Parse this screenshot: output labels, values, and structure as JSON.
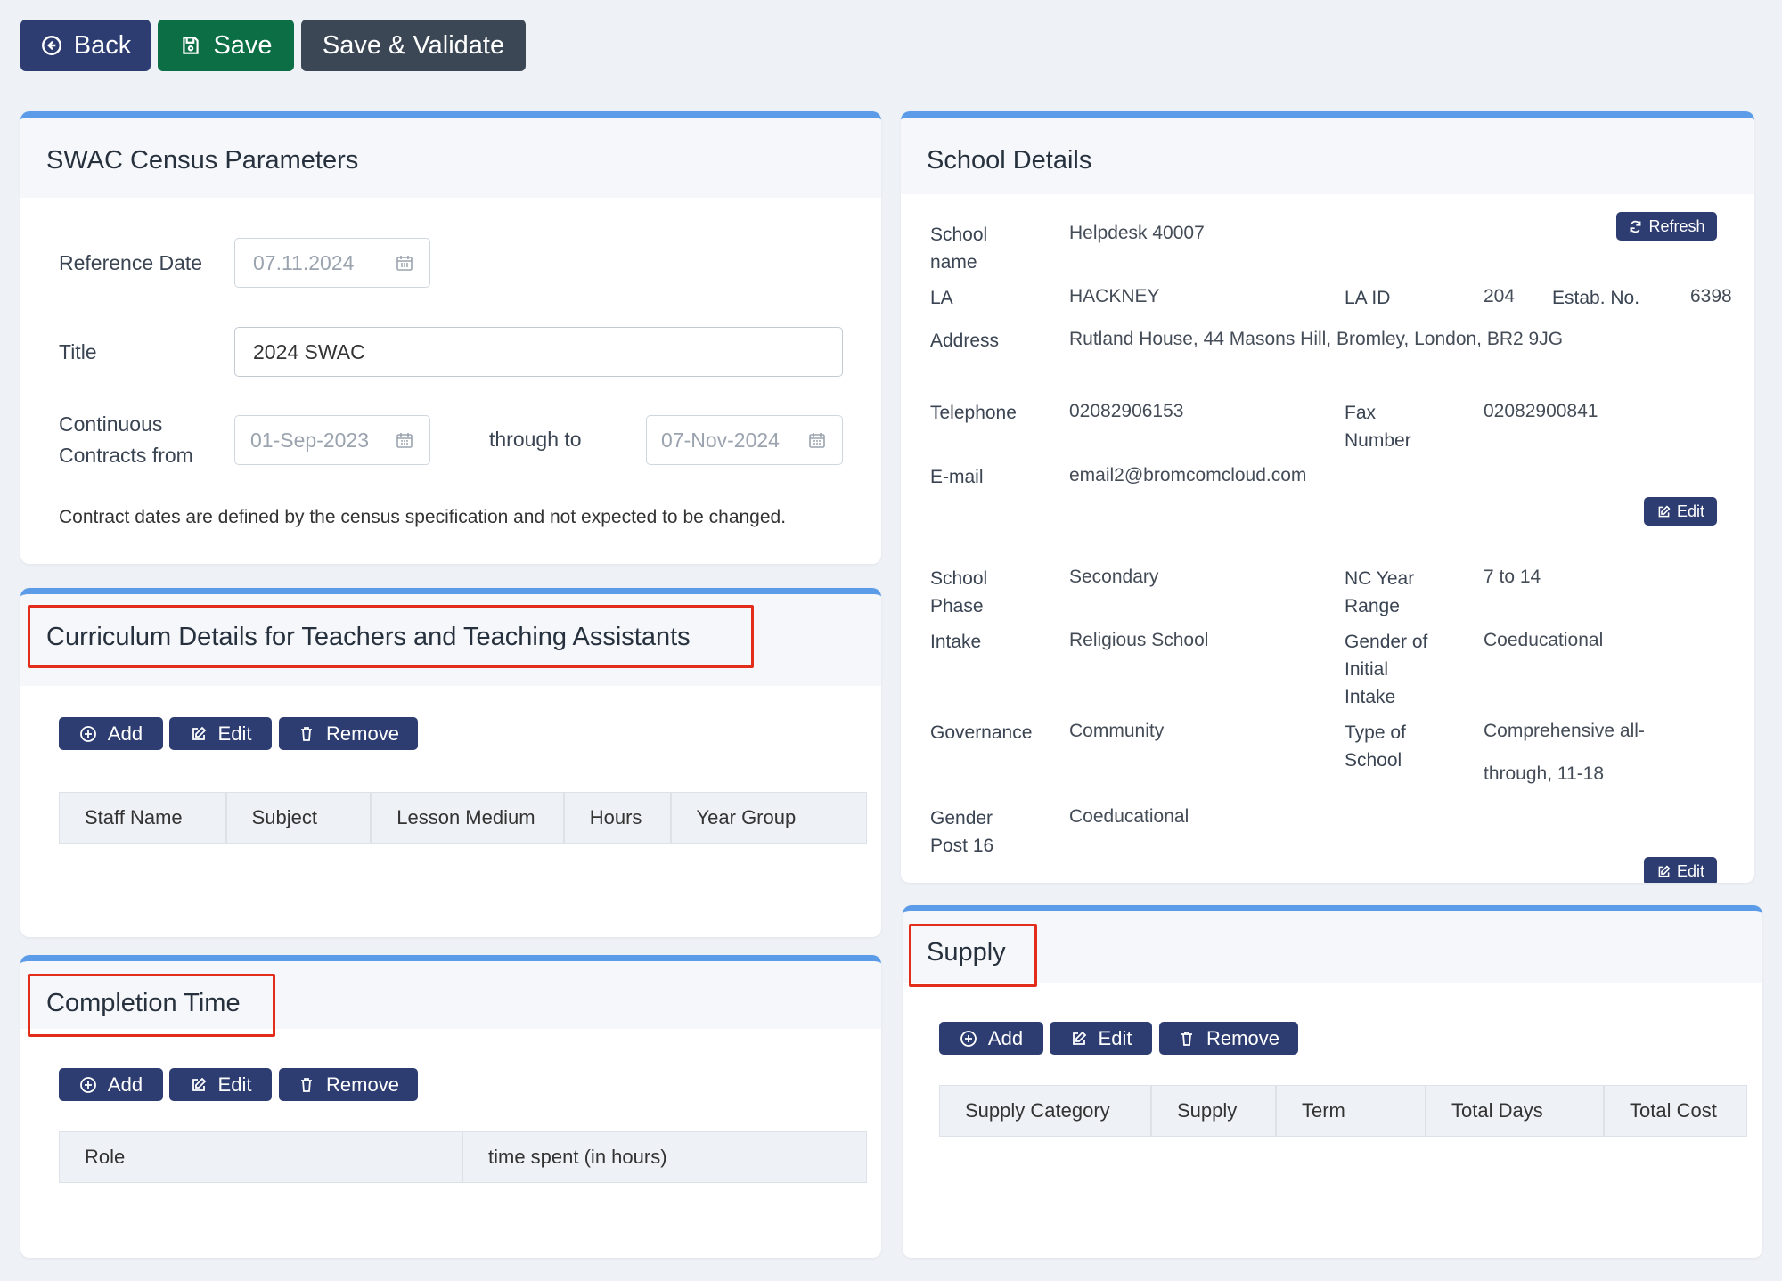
{
  "toolbar": {
    "back_label": "Back",
    "save_label": "Save",
    "save_validate_label": "Save & Validate"
  },
  "census": {
    "title": "SWAC Census Parameters",
    "reference_date_label": "Reference Date",
    "reference_date_value": "07.11.2024",
    "title_label": "Title",
    "title_value": "2024 SWAC",
    "contracts_label_line1": "Continuous",
    "contracts_label_line2": "Contracts from",
    "from_date": "01-Sep-2023",
    "through_label": "through to",
    "to_date": "07-Nov-2024",
    "note": "Contract dates are defined by the census specification and not expected to be changed."
  },
  "curriculum": {
    "title": "Curriculum Details for Teachers and Teaching Assistants",
    "add_label": "Add",
    "edit_label": "Edit",
    "remove_label": "Remove",
    "columns": [
      "Staff Name",
      "Subject",
      "Lesson Medium",
      "Hours",
      "Year Group"
    ]
  },
  "completion": {
    "title": "Completion Time",
    "add_label": "Add",
    "edit_label": "Edit",
    "remove_label": "Remove",
    "columns": [
      "Role",
      "time spent (in hours)"
    ]
  },
  "school": {
    "title": "School Details",
    "refresh_label": "Refresh",
    "edit_label": "Edit",
    "name_label_1": "School",
    "name_label_2": "name",
    "name_value": "Helpdesk 40007",
    "la_label": "LA",
    "la_value": "HACKNEY",
    "la_id_label": "LA ID",
    "la_id_value": "204",
    "estab_label": "Estab. No.",
    "estab_value": "6398",
    "address_label": "Address",
    "address_value": "Rutland House, 44 Masons Hill, Bromley, London, BR2 9JG",
    "telephone_label": "Telephone",
    "telephone_value": "02082906153",
    "fax_label_1": "Fax",
    "fax_label_2": "Number",
    "fax_value": "02082900841",
    "email_label": "E-mail",
    "email_value": "email2@bromcomcloud.com",
    "phase_label_1": "School",
    "phase_label_2": "Phase",
    "phase_value": "Secondary",
    "nc_label_1": "NC Year",
    "nc_label_2": "Range",
    "nc_value": "7 to 14",
    "intake_label": "Intake",
    "intake_value": "Religious School",
    "gender_initial_label_1": "Gender of",
    "gender_initial_label_2": "Initial",
    "gender_initial_label_3": "Intake",
    "gender_initial_value": "Coeducational",
    "governance_label": "Governance",
    "governance_value": "Community",
    "type_label_1": "Type of",
    "type_label_2": "School",
    "type_value_1": "Comprehensive all-",
    "type_value_2": "through, 11-18",
    "gender16_label_1": "Gender",
    "gender16_label_2": "Post 16",
    "gender16_value": "Coeducational"
  },
  "supply": {
    "title": "Supply",
    "add_label": "Add",
    "edit_label": "Edit",
    "remove_label": "Remove",
    "columns": [
      "Supply Category",
      "Supply",
      "Term",
      "Total Days",
      "Total Cost"
    ]
  }
}
